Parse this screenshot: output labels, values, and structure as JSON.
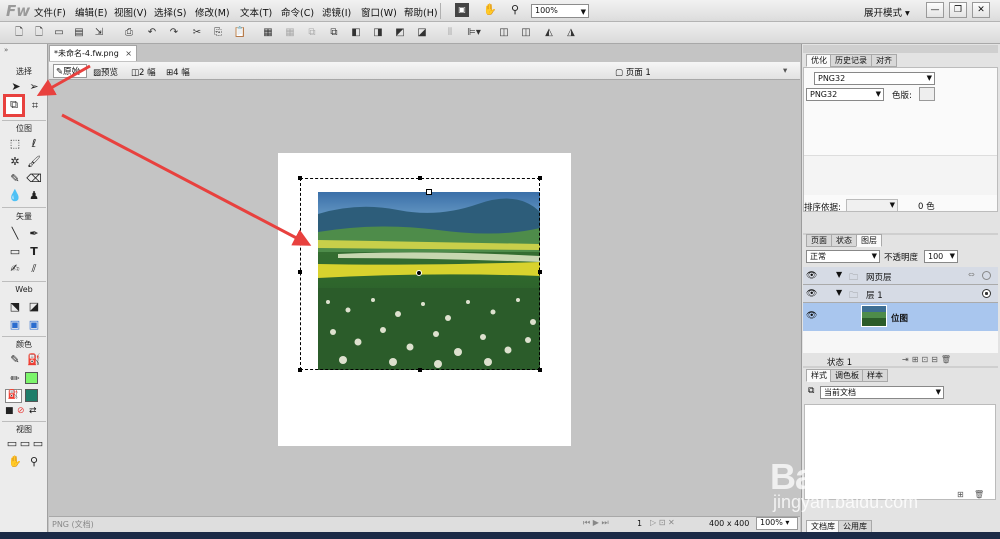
{
  "app": {
    "logo": "Fw",
    "workspace": "展开模式",
    "zoom": "100%"
  },
  "menu": [
    "文件(F)",
    "编辑(E)",
    "视图(V)",
    "选择(S)",
    "修改(M)",
    "文本(T)",
    "命令(C)",
    "滤镜(I)",
    "窗口(W)",
    "帮助(H)"
  ],
  "tools": {
    "select_label": "选择",
    "bitmap_label": "位图",
    "vector_label": "矢量",
    "web_label": "Web",
    "color_label": "颜色",
    "view_label": "视图"
  },
  "document": {
    "tab_title": "*未命名-4.fw.png",
    "tab_close": "×",
    "views": [
      "原始",
      "预览",
      "2 幅",
      "4 幅"
    ],
    "page_label": "页面 1"
  },
  "status": {
    "file_type": "PNG (文档)",
    "frame": "1",
    "size": "400 x 400",
    "zoom": "100%"
  },
  "optimize": {
    "tabs": [
      "优化",
      "历史记录",
      "对齐"
    ],
    "format": "PNG32",
    "format2": "PNG32",
    "colors_label": "色版:",
    "sort_label": "排序依据:",
    "color_count": "0 色"
  },
  "layers": {
    "tabs": [
      "页面",
      "状态",
      "图层"
    ],
    "blend": "正常",
    "opacity_label": "不透明度",
    "opacity": "100",
    "items": [
      {
        "name": "网页层"
      },
      {
        "name": "层 1"
      },
      {
        "name": "位图"
      }
    ],
    "state": "状态 1"
  },
  "styles": {
    "tabs": [
      "样式",
      "调色板",
      "样本"
    ],
    "doc": "当前文档",
    "bottom_tabs": [
      "文档库",
      "公用库"
    ]
  },
  "watermark": {
    "brand": "Bai 经验",
    "url": "jingyan.baidu.com"
  },
  "colors": {
    "accent": "#e8413e",
    "selection": "#a9c6ee",
    "stroke": "#2e8f2e",
    "fill": "#7cf56b"
  }
}
